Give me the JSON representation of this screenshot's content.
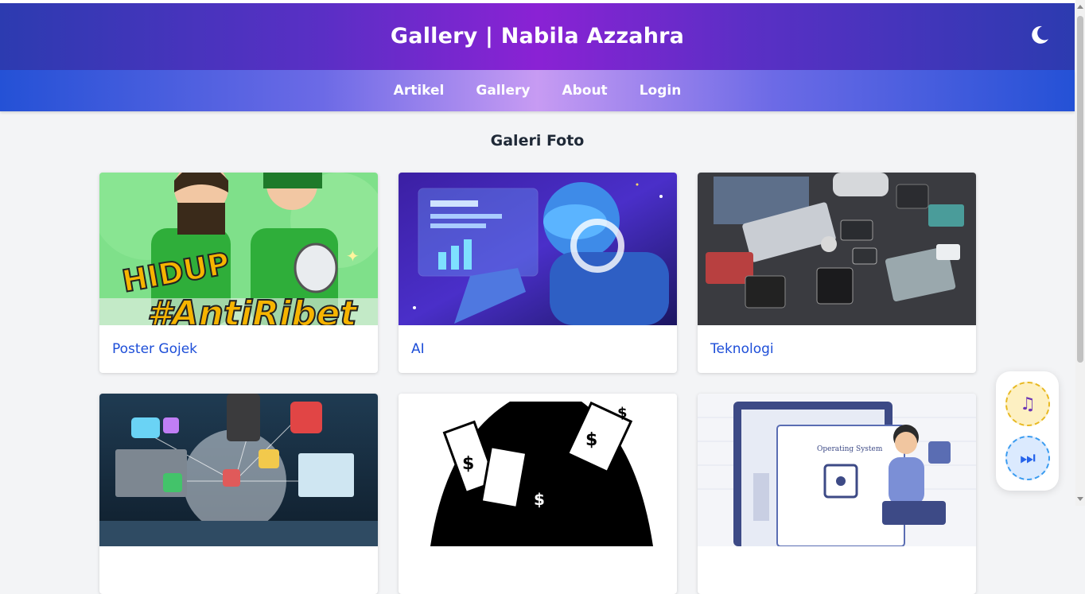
{
  "header": {
    "title": "Gallery | Nabila Azzahra",
    "theme_icon": "moon-icon"
  },
  "nav": {
    "items": [
      {
        "label": "Artikel"
      },
      {
        "label": "Gallery"
      },
      {
        "label": "About"
      },
      {
        "label": "Login"
      }
    ]
  },
  "gallery": {
    "heading": "Galeri Foto",
    "cards": [
      {
        "title": "Poster Gojek",
        "image": "gojek-poster-illustration"
      },
      {
        "title": "AI",
        "image": "ai-robot-illustration"
      },
      {
        "title": "Teknologi",
        "image": "tech-devices-photo"
      },
      {
        "title": "",
        "image": "network-devices-illustration"
      },
      {
        "title": "",
        "image": "money-bag-sketch"
      },
      {
        "title": "",
        "image": "operating-system-illustration"
      }
    ]
  },
  "player": {
    "music_icon": "music-note-icon",
    "skip_icon": "skip-forward-icon"
  },
  "colors": {
    "header_gradient_center": "#8a22d4",
    "header_gradient_edge": "#2c3bb0",
    "nav_gradient_center": "#c79bf3",
    "nav_gradient_edge": "#2451d6",
    "card_title": "#1d4ed8"
  }
}
